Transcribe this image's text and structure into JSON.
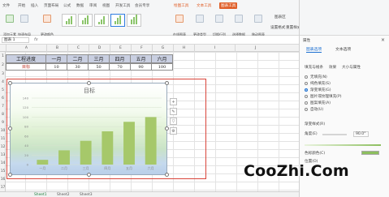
{
  "menu": [
    "文件",
    "开始",
    "插入",
    "页面布局",
    "公式",
    "数据",
    "审阅",
    "视图",
    "开发工具",
    "会员专享",
    "绘图工具",
    "文本工具",
    "图表工具"
  ],
  "active_menu": "图表工具",
  "ribbon_tools": [
    {
      "label": "添加元素"
    },
    {
      "label": "快速布局"
    },
    {
      "label": "更改颜色"
    },
    {
      "label": "在线图表"
    },
    {
      "label": "更改类型"
    },
    {
      "label": "切换行列"
    },
    {
      "label": "选择数据"
    },
    {
      "label": "移动图表"
    },
    {
      "label": "设置格式"
    },
    {
      "label": "重置样式"
    }
  ],
  "ribbon_group_label": "图表区",
  "formula_bar": {
    "name_box": "图表 1",
    "fx": "fx"
  },
  "columns": [
    "A",
    "B",
    "C",
    "D",
    "E",
    "F",
    "G",
    "H",
    "I",
    "J"
  ],
  "rows": [
    "1",
    "2",
    "3",
    "4",
    "5",
    "6",
    "7",
    "8",
    "9",
    "10",
    "11",
    "12",
    "13",
    "14",
    "15",
    "16",
    "17"
  ],
  "table": {
    "header_label": "工程进度",
    "months": [
      "一月",
      "二月",
      "三月",
      "四月",
      "五月",
      "六月"
    ],
    "row_label": "目标",
    "values": [
      "10",
      "30",
      "50",
      "70",
      "90",
      "100"
    ]
  },
  "chart_data": {
    "type": "bar",
    "title": "目标",
    "categories": [
      "一月",
      "二月",
      "三月",
      "四月",
      "五月",
      "六月"
    ],
    "values": [
      10,
      30,
      50,
      70,
      90,
      100
    ],
    "ylim": [
      0,
      140
    ],
    "yticks": [
      "0",
      "20",
      "40",
      "60",
      "80",
      "100",
      "120",
      "140"
    ],
    "bar_color": "#a6c86a",
    "grid": true,
    "legend": "none"
  },
  "chart_tools": [
    "+",
    "✎",
    "▽",
    "⚙"
  ],
  "sheet_tabs": [
    "Sheet1",
    "Sheet2",
    "Sheet3"
  ],
  "pane": {
    "title": "属性",
    "tabs": [
      "图表选项",
      "文本选项"
    ],
    "sub_tabs": [
      "填充与线条",
      "效果",
      "大小与属性"
    ],
    "fill_options": [
      "无填充(N)",
      "纯色填充(S)",
      "渐变填充(G)",
      "图片或纹理填充(P)",
      "图案填充(A)",
      "自动(U)"
    ],
    "selected_fill": "渐变填充(G)",
    "gradient_label": "渐变样式(R)",
    "angle_label": "角度(E)",
    "angle_value": "90.0°",
    "color_label": "色标颜色(C)",
    "position_label": "位置(O)"
  },
  "watermark": "CooZhi.Com"
}
